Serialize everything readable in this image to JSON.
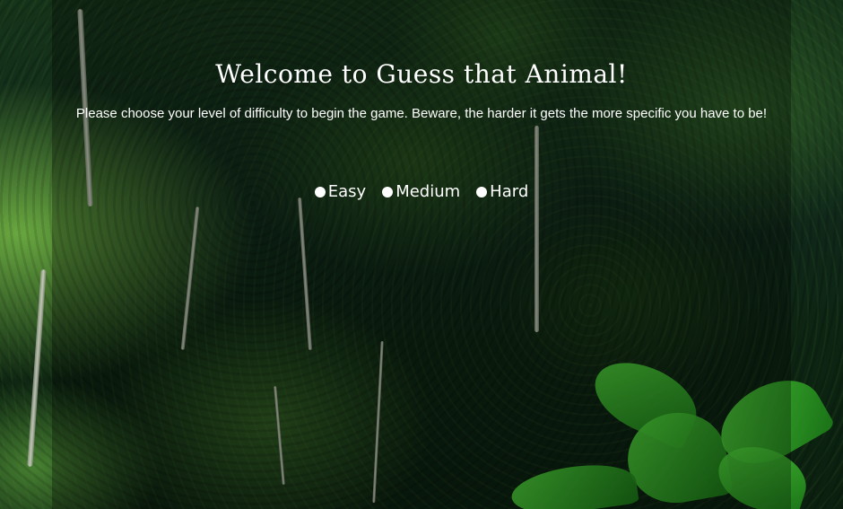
{
  "header": {
    "title": "Welcome to Guess that Animal!",
    "intro": "Please choose your level of difficulty to begin the game. Beware, the harder it gets the more specific you have to be!"
  },
  "difficulty": {
    "options": [
      {
        "label": "Easy"
      },
      {
        "label": "Medium"
      },
      {
        "label": "Hard"
      }
    ]
  },
  "background": {
    "scene": "rainforest-canopy",
    "overlay_color": "#000000",
    "accent_green": "#4fd23a"
  }
}
